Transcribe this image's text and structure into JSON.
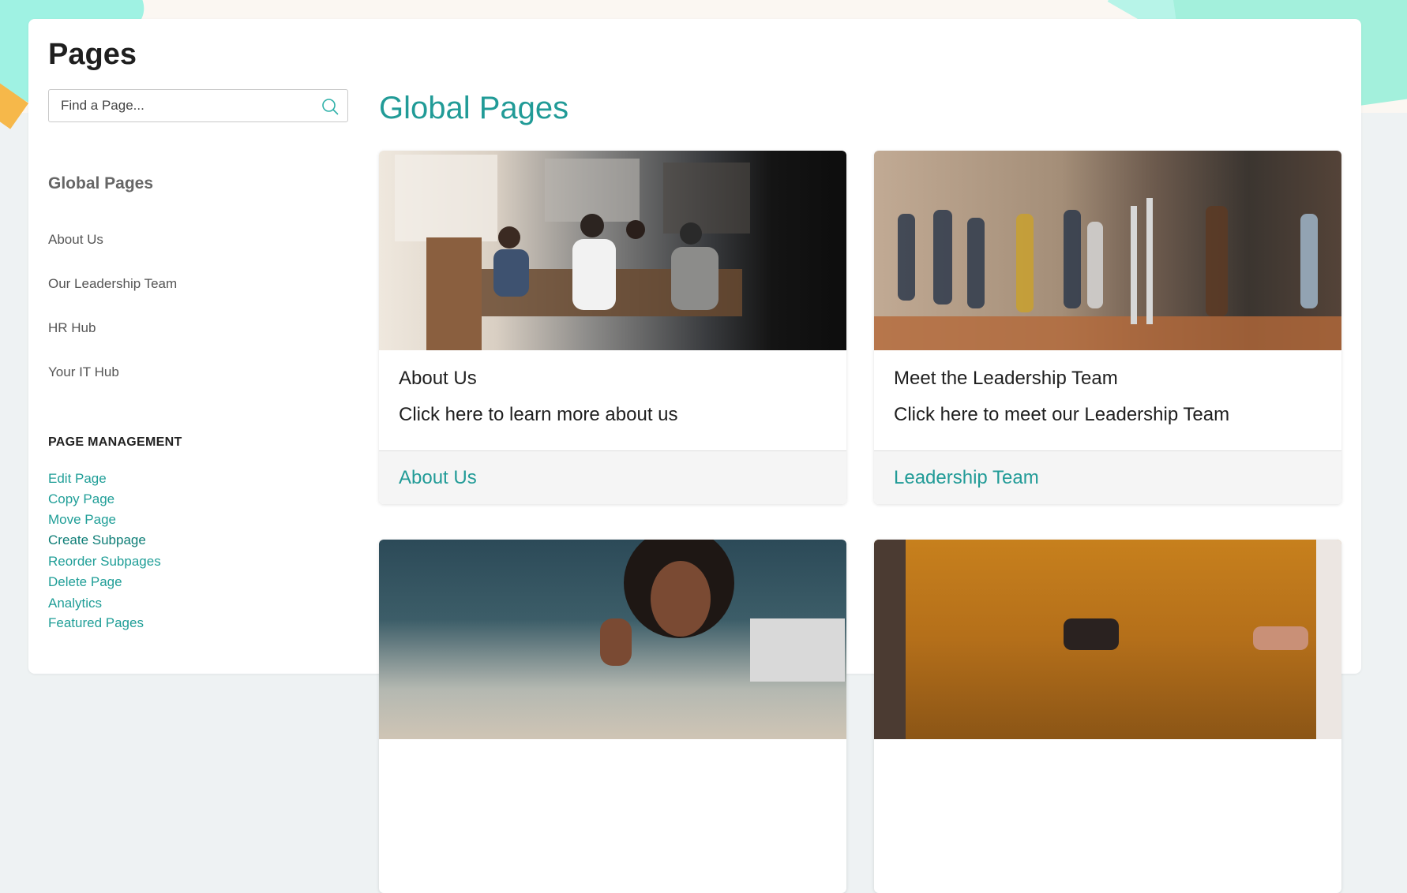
{
  "page": {
    "title": "Pages"
  },
  "search": {
    "placeholder": "Find a Page..."
  },
  "sidebar": {
    "heading": "Global Pages",
    "items": [
      {
        "label": "About Us"
      },
      {
        "label": "Our Leadership Team"
      },
      {
        "label": "HR Hub"
      },
      {
        "label": "Your IT Hub"
      }
    ]
  },
  "management": {
    "heading": "PAGE MANAGEMENT",
    "items": [
      {
        "label": "Edit Page"
      },
      {
        "label": "Copy Page"
      },
      {
        "label": "Move Page"
      },
      {
        "label": "Create Subpage"
      },
      {
        "label": "Reorder Subpages"
      },
      {
        "label": "Delete Page"
      },
      {
        "label": "Analytics"
      },
      {
        "label": "Featured Pages"
      }
    ]
  },
  "main": {
    "section_title": "Global Pages",
    "cards": [
      {
        "title": "About Us",
        "description": "Click here to learn more about us",
        "link": "About Us"
      },
      {
        "title": "Meet the Leadership Team",
        "description": "Click here to meet our Leadership Team",
        "link": "Leadership Team"
      }
    ]
  },
  "colors": {
    "accent": "#219b97",
    "accent_dark": "#0d7d76",
    "background": "#eef2f3"
  }
}
